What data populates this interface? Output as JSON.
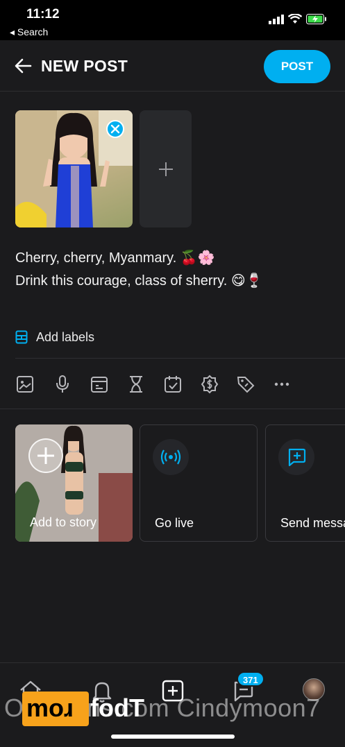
{
  "status_bar": {
    "time": "11:12",
    "back_label": "◂ Search"
  },
  "header": {
    "title": "NEW POST",
    "post_label": "POST"
  },
  "caption": {
    "line1": "Cherry, cherry, Myanmary. 🍒🌸",
    "line2": "Drink this courage, class of sherry. 😋🍷"
  },
  "labels": {
    "add_label": "Add labels"
  },
  "toolbar": {
    "icons": [
      "image-icon",
      "microphone-icon",
      "gallery-icon",
      "hourglass-icon",
      "calendar-check-icon",
      "dollar-icon",
      "price-tag-icon",
      "more-icon"
    ]
  },
  "cards": {
    "story": "Add to story",
    "live": "Go live",
    "message": "Send message"
  },
  "bottom_nav": {
    "notifications_badge": "371"
  },
  "watermark": {
    "text": "OnlyFans.com Cindymoon7",
    "logo_a": "moɹ",
    "logo_b": "fodT"
  },
  "colors": {
    "accent": "#00aff0",
    "background": "#1b1b1d"
  }
}
